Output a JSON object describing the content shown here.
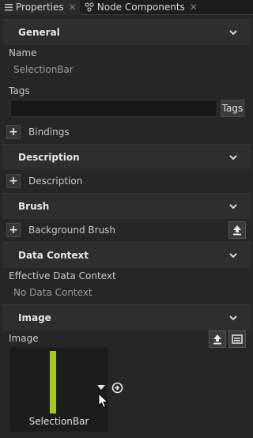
{
  "tabs": [
    {
      "label": "Properties",
      "active": true
    },
    {
      "label": "Node Components",
      "active": false
    }
  ],
  "sections": {
    "general": "General",
    "description": "Description",
    "brush": "Brush",
    "data_context": "Data Context",
    "image": "Image"
  },
  "general": {
    "name_label": "Name",
    "name_value": "SelectionBar",
    "tags_label": "Tags",
    "tags_value": "",
    "tags_button": "Tags"
  },
  "rows": {
    "bindings": "Bindings",
    "description": "Description",
    "background_brush": "Background Brush"
  },
  "data_context": {
    "effective_label": "Effective Data Context",
    "effective_value": "No Data Context"
  },
  "image": {
    "label": "Image",
    "thumbnail_name": "SelectionBar",
    "thumbnail_color": "#a5c81a"
  }
}
